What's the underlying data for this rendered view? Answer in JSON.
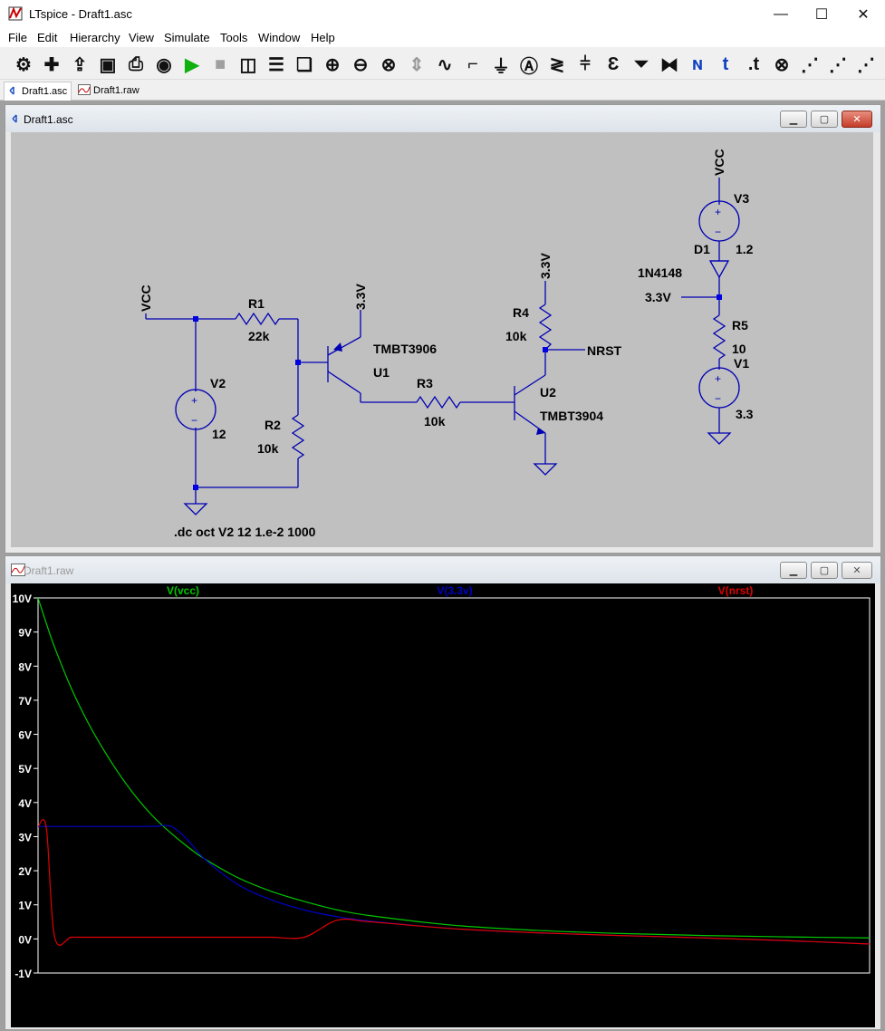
{
  "window": {
    "title": "LTspice - Draft1.asc",
    "minimize": "—",
    "maximize": "☐",
    "close": "✕"
  },
  "menu": [
    "File",
    "Edit",
    "Hierarchy",
    "View",
    "Simulate",
    "Tools",
    "Window",
    "Help"
  ],
  "toolbar_icons": [
    "gear-icon",
    "new-schematic-icon",
    "open-icon",
    "save-icon",
    "print-icon",
    "ac-analysis-icon",
    "run-icon",
    "halt-icon",
    "tile-vertical-icon",
    "tile-horizontal-icon",
    "cascade-icon",
    "zoom-in-icon",
    "zoom-out-icon",
    "zoom-fit-icon",
    "autorange-icon",
    "waveform-icon",
    "wire-icon",
    "ground-icon",
    "label-net-icon",
    "resistor-icon",
    "capacitor-icon",
    "inductor-icon",
    "diode-icon",
    "component-icon",
    "netlist-icon",
    "text-icon",
    "spice-directive-icon",
    "delete-icon",
    "duplicate-icon",
    "move-icon",
    "drag-icon"
  ],
  "tabs": [
    {
      "label": "Draft1.asc",
      "icon": "schematic-icon"
    },
    {
      "label": "Draft1.raw",
      "icon": "waveform-icon"
    }
  ],
  "schematic": {
    "title": "Draft1.asc",
    "labels": {
      "vcc_left": "VCC",
      "r1_name": "R1",
      "r1_value": "22k",
      "r2_name": "R2",
      "r2_value": "10k",
      "r3_name": "R3",
      "r3_value": "10k",
      "r4_name": "R4",
      "r4_value": "10k",
      "r5_name": "R5",
      "r5_value": "10",
      "v2_name": "V2",
      "v2_value": "12",
      "v3_name": "V3",
      "v3_value": "1.2",
      "v1_name": "V1",
      "v1_value": "3.3",
      "u1_model": "TMBT3906",
      "u1_name": "U1",
      "u2_model": "TMBT3904",
      "u2_name": "U2",
      "d1_name": "D1",
      "d1_model": "1N4148",
      "net_33v_u1": "3.3V",
      "net_33v_r4": "3.3V",
      "net_33v_d1": "3.3V",
      "vcc_v3": "VCC",
      "nrst": "NRST",
      "directive": ".dc oct V2 12 1.e-2 1000"
    }
  },
  "waveform": {
    "title": "Draft1.raw",
    "colors": {
      "vcc": "#00c800",
      "v33": "#0000c8",
      "nrst": "#e00000"
    },
    "chart_data": {
      "type": "line",
      "title": "",
      "xlabel": "",
      "ylabel": "",
      "ylim": [
        -1,
        10
      ],
      "yticks": [
        "10V",
        "9V",
        "8V",
        "7V",
        "6V",
        "5V",
        "4V",
        "3V",
        "2V",
        "1V",
        "0V",
        "-1V"
      ],
      "grid": false,
      "legend": "top",
      "x": [
        0,
        0.01,
        0.02,
        0.04,
        0.06,
        0.08,
        0.1,
        0.12,
        0.14,
        0.16,
        0.18,
        0.2,
        0.24,
        0.28,
        0.32,
        0.36,
        0.4,
        0.5,
        0.6,
        0.7,
        0.8,
        0.9,
        1.0
      ],
      "series": [
        {
          "name": "V(vcc)",
          "values": [
            10,
            9.25,
            8.55,
            7.35,
            6.35,
            5.5,
            4.75,
            4.1,
            3.55,
            3.1,
            2.7,
            2.35,
            1.8,
            1.4,
            1.1,
            0.85,
            0.68,
            0.4,
            0.25,
            0.16,
            0.1,
            0.06,
            0.03
          ]
        },
        {
          "name": "V(3.3v)",
          "values": [
            3.3,
            3.3,
            3.3,
            3.3,
            3.3,
            3.3,
            3.3,
            3.3,
            3.3,
            3.3,
            2.9,
            2.35,
            1.6,
            1.15,
            0.85,
            0.65,
            0.52,
            0.3,
            0.18,
            0.1,
            0.03,
            -0.05,
            -0.15
          ]
        },
        {
          "name": "V(nrst)",
          "values": [
            3.3,
            3.25,
            0.05,
            0.05,
            0.05,
            0.05,
            0.05,
            0.05,
            0.05,
            0.05,
            0.05,
            0.05,
            0.05,
            0.05,
            0.05,
            0.55,
            0.5,
            0.3,
            0.18,
            0.1,
            0.03,
            -0.05,
            -0.15
          ]
        }
      ]
    }
  }
}
